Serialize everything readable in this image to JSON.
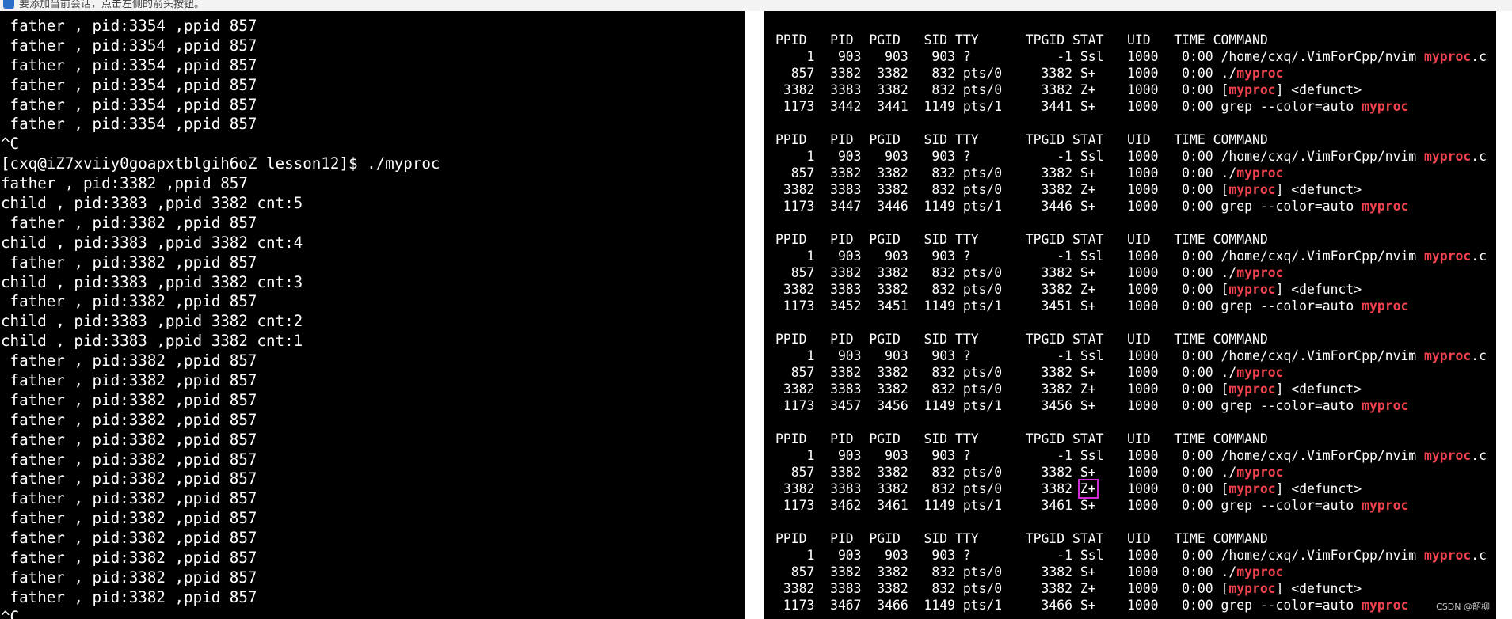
{
  "top_bar": {
    "text": "要添加当前会话，点击左侧的箭头按钮。"
  },
  "left_terminal": {
    "lines": [
      " father , pid:3354 ,ppid 857",
      " father , pid:3354 ,ppid 857",
      " father , pid:3354 ,ppid 857",
      " father , pid:3354 ,ppid 857",
      " father , pid:3354 ,ppid 857",
      " father , pid:3354 ,ppid 857",
      "^C",
      "[cxq@iZ7xviiy0goapxtblgih6oZ lesson12]$ ./myproc",
      "father , pid:3382 ,ppid 857",
      "child , pid:3383 ,ppid 3382 cnt:5",
      " father , pid:3382 ,ppid 857",
      "child , pid:3383 ,ppid 3382 cnt:4",
      " father , pid:3382 ,ppid 857",
      "child , pid:3383 ,ppid 3382 cnt:3",
      " father , pid:3382 ,ppid 857",
      "child , pid:3383 ,ppid 3382 cnt:2",
      "child , pid:3383 ,ppid 3382 cnt:1",
      " father , pid:3382 ,ppid 857",
      " father , pid:3382 ,ppid 857",
      " father , pid:3382 ,ppid 857",
      " father , pid:3382 ,ppid 857",
      " father , pid:3382 ,ppid 857",
      " father , pid:3382 ,ppid 857",
      " father , pid:3382 ,ppid 857",
      " father , pid:3382 ,ppid 857",
      " father , pid:3382 ,ppid 857",
      " father , pid:3382 ,ppid 857",
      " father , pid:3382 ,ppid 857",
      " father , pid:3382 ,ppid 857",
      " father , pid:3382 ,ppid 857",
      "^C"
    ]
  },
  "right_terminal": {
    "header": "PPID   PID  PGID   SID TTY      TPGID STAT   UID   TIME COMMAND",
    "highlight_word": "myproc",
    "blocks": [
      [
        "    1   903   903   903 ?           -1 Ssl   1000   0:00 /home/cxq/.VimForCpp/nvim myproc.c",
        "  857  3382  3382   832 pts/0     3382 S+    1000   0:00 ./myproc",
        " 3382  3383  3382   832 pts/0     3382 Z+    1000   0:00 [myproc] <defunct>",
        " 1173  3442  3441  1149 pts/1     3441 S+    1000   0:00 grep --color=auto myproc"
      ],
      [
        "    1   903   903   903 ?           -1 Ssl   1000   0:00 /home/cxq/.VimForCpp/nvim myproc.c",
        "  857  3382  3382   832 pts/0     3382 S+    1000   0:00 ./myproc",
        " 3382  3383  3382   832 pts/0     3382 Z+    1000   0:00 [myproc] <defunct>",
        " 1173  3447  3446  1149 pts/1     3446 S+    1000   0:00 grep --color=auto myproc"
      ],
      [
        "    1   903   903   903 ?           -1 Ssl   1000   0:00 /home/cxq/.VimForCpp/nvim myproc.c",
        "  857  3382  3382   832 pts/0     3382 S+    1000   0:00 ./myproc",
        " 3382  3383  3382   832 pts/0     3382 Z+    1000   0:00 [myproc] <defunct>",
        " 1173  3452  3451  1149 pts/1     3451 S+    1000   0:00 grep --color=auto myproc"
      ],
      [
        "    1   903   903   903 ?           -1 Ssl   1000   0:00 /home/cxq/.VimForCpp/nvim myproc.c",
        "  857  3382  3382   832 pts/0     3382 S+    1000   0:00 ./myproc",
        " 3382  3383  3382   832 pts/0     3382 Z+    1000   0:00 [myproc] <defunct>",
        " 1173  3457  3456  1149 pts/1     3456 S+    1000   0:00 grep --color=auto myproc"
      ],
      [
        "    1   903   903   903 ?           -1 Ssl   1000   0:00 /home/cxq/.VimForCpp/nvim myproc.c",
        "  857  3382  3382   832 pts/0     3382 S+    1000   0:00 ./myproc",
        " 3382  3383  3382   832 pts/0     3382 Z+    1000   0:00 [myproc] <defunct>",
        " 1173  3462  3461  1149 pts/1     3461 S+    1000   0:00 grep --color=auto myproc"
      ],
      [
        "    1   903   903   903 ?           -1 Ssl   1000   0:00 /home/cxq/.VimForCpp/nvim myproc.c",
        "  857  3382  3382   832 pts/0     3382 S+    1000   0:00 ./myproc",
        " 3382  3383  3382   832 pts/0     3382 Z+    1000   0:00 [myproc] <defunct>",
        " 1173  3467  3466  1149 pts/1     3466 S+    1000   0:00 grep --color=auto myproc"
      ]
    ],
    "boxed": {
      "block": 4,
      "line": 2,
      "text": "Z+"
    }
  },
  "watermark": "CSDN @韶柳"
}
